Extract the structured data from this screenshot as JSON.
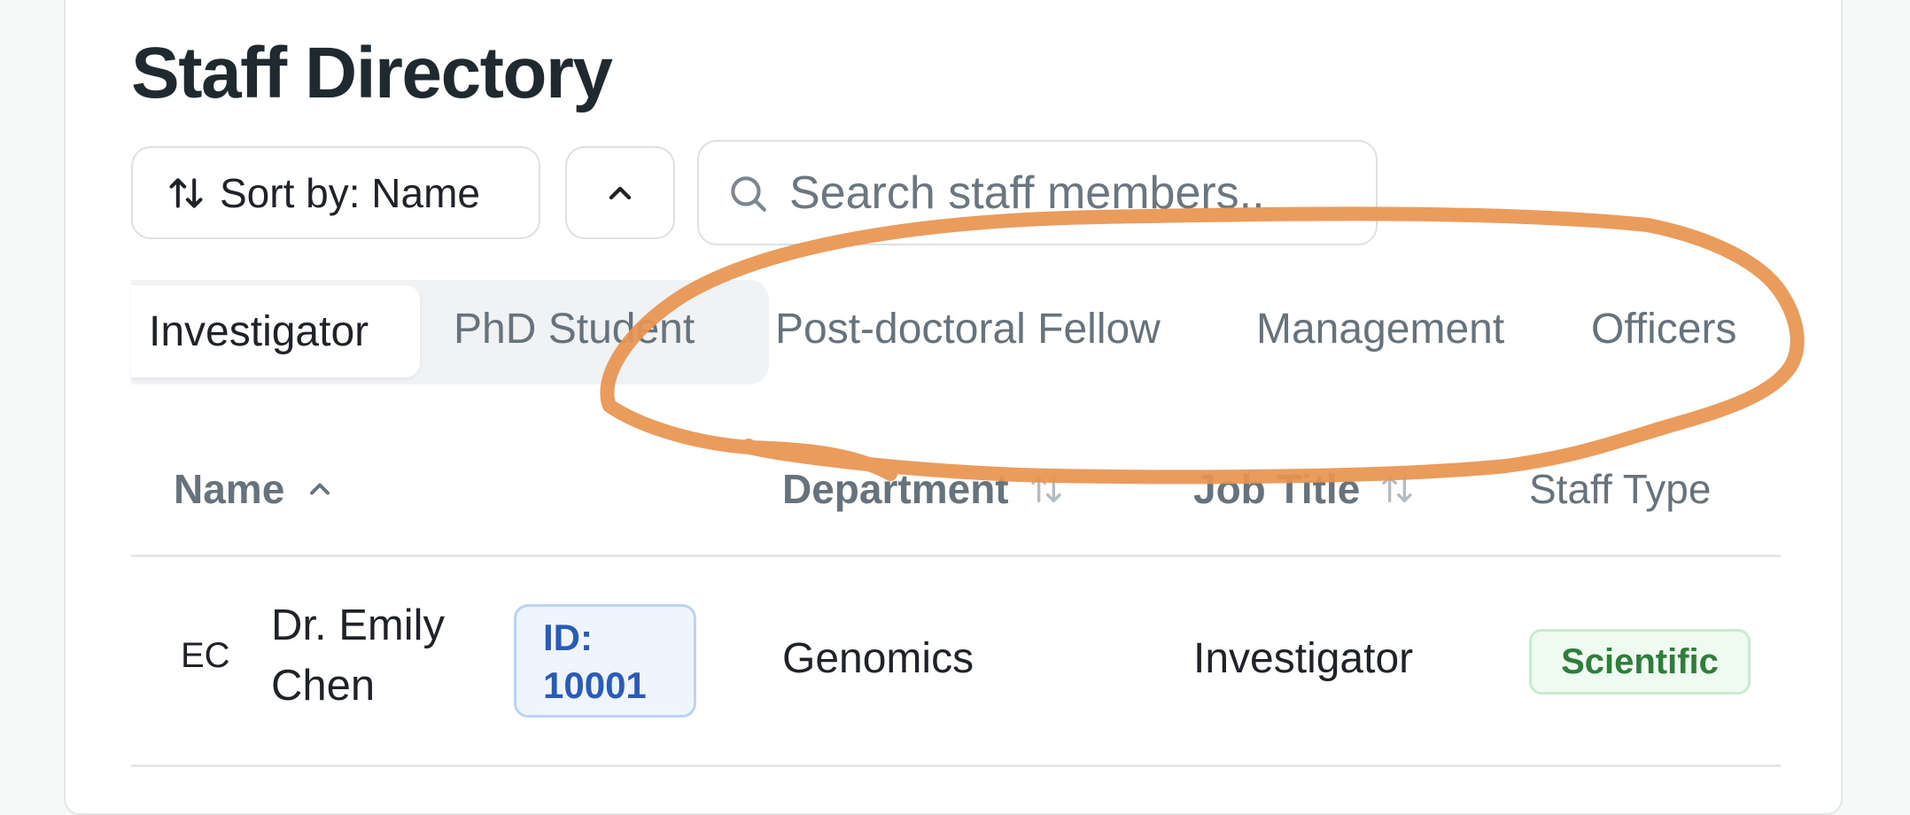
{
  "page": {
    "title": "Staff Directory"
  },
  "toolbar": {
    "sort_label": "Sort by: Name",
    "search_placeholder": "Search staff members.."
  },
  "tabs": [
    {
      "label": "Investigator",
      "active": true
    },
    {
      "label": "PhD Student",
      "active": false
    },
    {
      "label": "Post-doctoral Fellow",
      "active": false
    },
    {
      "label": "Management",
      "active": false
    },
    {
      "label": "Officers",
      "active": false
    }
  ],
  "table": {
    "columns": [
      {
        "label": "Name",
        "sort": "ascending"
      },
      {
        "label": "Department",
        "sort": "sortable"
      },
      {
        "label": "Job Title",
        "sort": "sortable"
      },
      {
        "label": "Staff Type",
        "sort": "none"
      }
    ],
    "rows": [
      {
        "initials": "EC",
        "name_line1": "Dr. Emily",
        "name_line2": "Chen",
        "id_line1": "ID:",
        "id_line2": "10001",
        "department": "Genomics",
        "job_title": "Investigator",
        "staff_type": "Scientific"
      }
    ]
  },
  "colors": {
    "annotation_stroke": "#e8944f",
    "accent_blue": "#2a5bb6",
    "badge_green": "#2f7d3a"
  },
  "icons": {
    "sort": "sort-arrows-icon",
    "direction": "chevron-up-icon",
    "search": "search-icon"
  }
}
